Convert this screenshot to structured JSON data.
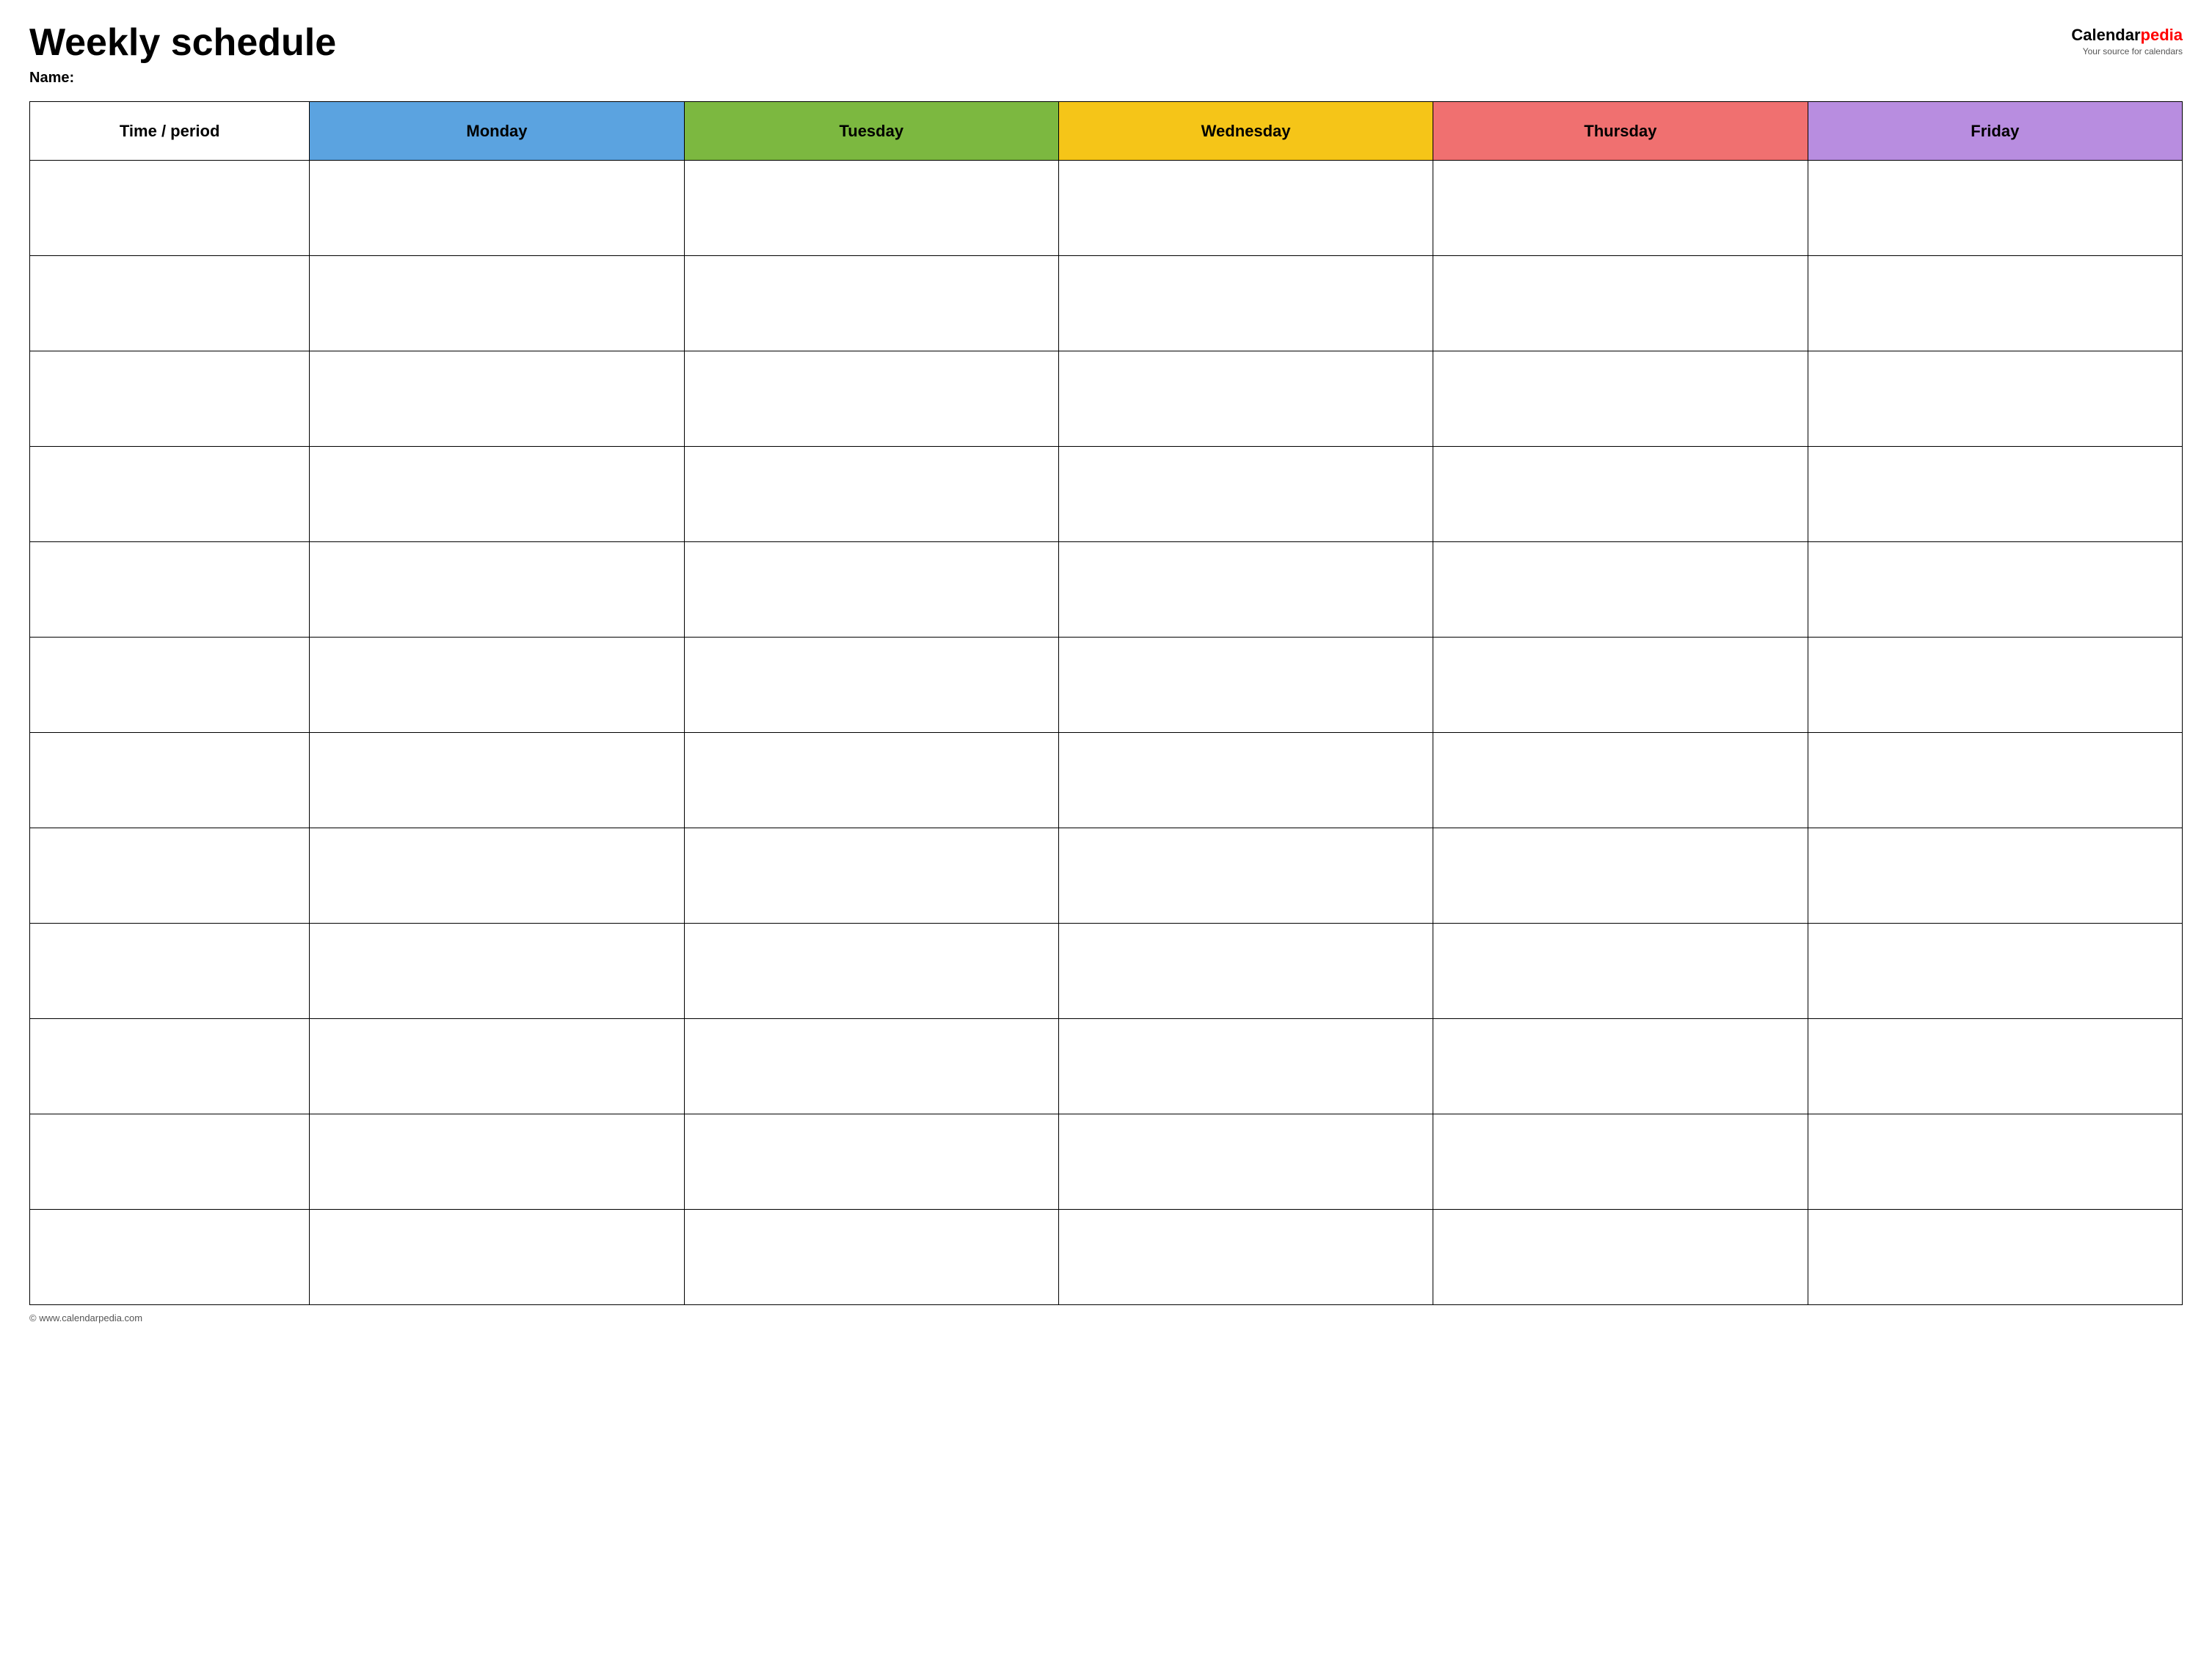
{
  "header": {
    "title": "Weekly schedule",
    "name_label": "Name:",
    "logo_calendar": "Calendar",
    "logo_pedia": "pedia",
    "logo_tagline": "Your source for calendars"
  },
  "table": {
    "columns": [
      {
        "id": "time",
        "label": "Time / period",
        "color": "#ffffff",
        "class": "th-time"
      },
      {
        "id": "monday",
        "label": "Monday",
        "color": "#5ba3e0",
        "class": "th-monday"
      },
      {
        "id": "tuesday",
        "label": "Tuesday",
        "color": "#7cb840",
        "class": "th-tuesday"
      },
      {
        "id": "wednesday",
        "label": "Wednesday",
        "color": "#f5c518",
        "class": "th-wednesday"
      },
      {
        "id": "thursday",
        "label": "Thursday",
        "color": "#f07070",
        "class": "th-thursday"
      },
      {
        "id": "friday",
        "label": "Friday",
        "color": "#b88de0",
        "class": "th-friday"
      }
    ],
    "row_count": 12
  },
  "footer": {
    "copyright": "© www.calendarpedia.com"
  }
}
